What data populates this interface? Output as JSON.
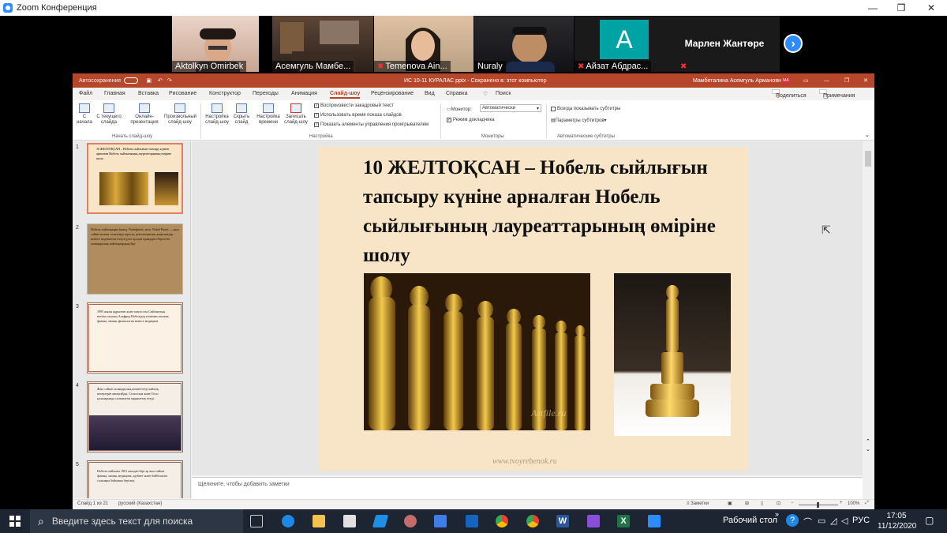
{
  "window": {
    "title": "Zoom Конференция",
    "min": "—",
    "max": "❐",
    "close": "✕"
  },
  "gallery": {
    "participants": [
      {
        "name": "Aktolkyn Omirbek",
        "muted": false
      },
      {
        "name": "Асемгуль Мамбе...",
        "muted": false
      },
      {
        "name": "Temenova Ain...",
        "muted": true
      },
      {
        "name": "Nuraly",
        "muted": false
      },
      {
        "name": "Айзат Абдрас...",
        "muted": true,
        "initial": "A"
      },
      {
        "name": "Марлен Жантөре",
        "muted": true
      }
    ],
    "next_page_icon": "chevron-right-icon"
  },
  "ppt": {
    "autosave_label": "Автосохранение",
    "file_title": "ИС 10-11 КУРАЛАС pptx - Сохранено в: этот компьютер",
    "user": "Мамбеталина Асемгуль Армановна",
    "user_initials": "МА",
    "tabs": [
      "Файл",
      "Главная",
      "Вставка",
      "Рисование",
      "Конструктор",
      "Переходы",
      "Анимация",
      "Слайд-шоу",
      "Рецензирование",
      "Вид",
      "Справка"
    ],
    "active_tab": "Слайд-шоу",
    "search_label": "Поиск",
    "share_label": "Поделиться",
    "comments_label": "Примечания",
    "ribbon": {
      "from_start": "С начала",
      "from_current": "С текущего слайда",
      "online": "Онлайн-презентация",
      "custom": "Произвольный слайд-шоу",
      "group_start": "Начать слайд-шоу",
      "setup": "Настройка слайд-шоу",
      "hide": "Скрыть слайд",
      "timing": "Настройка времени",
      "record": "Записать слайд-шоу",
      "chk_narration": "Воспроизвести закадровый текст",
      "chk_timings": "Использовать время показа слайдов",
      "chk_controls": "Показать элементы управления проигрывателем",
      "group_setup": "Настройка",
      "monitor_label": "Монитор:",
      "monitor_value": "Автоматически",
      "presenter_view": "Режим докладчика",
      "group_monitors": "Мониторы",
      "subtitles_always": "Всегда показывать субтитры",
      "subtitle_settings": "Параметры субтитров",
      "group_subtitles": "Автоматические субтитры"
    },
    "thumbnails": [
      {
        "num": "1",
        "text": "10 ЖЕЛТОҚСАН – Нобель сыйлығын тапсыру күніне арналған Нобель сыйлығының лауреаттарының өміріне шолу"
      },
      {
        "num": "2",
        "text": "Нобель сыйлықтары (швед. Nobelpriset, англ. Nobel Prize) — жыл сайын ғылым саласында зерттеу, революциялық жаңалықтар немесе мәдениетке елеулі үлес қосқан адамдарға берілетін халықаралық сыйлықтардың бірі"
      },
      {
        "num": "3",
        "text": "1895 жылы құрылған және атауы осы Сыйлықтың негізін салушы Альфред Нобельдің есімімен аталған: физика, химия, физиология немесе медицина"
      },
      {
        "num": "4",
        "text": "Жыл сайын халықаралық комитеттер сыйлық иегерлерін анықтайды. Стокгольм және Осло қалаларында салтанатты марапаттау өтеді."
      },
      {
        "num": "5",
        "text": "Нобель сыйлығы 1901 жылдан бері әр жыл сайын физика, химия, медицина, әдебиет және бейбітшілік салалары бойынша беріледі"
      }
    ],
    "slide": {
      "title": "10 ЖЕЛТОҚСАН – Нобель сыйлығын тапсыру күніне арналған Нобель сыйлығының лауреаттарының өміріне шолу",
      "image1_watermark": "Artfile.ru",
      "footer_watermark": "www.tvoyrebenok.ru"
    },
    "notes_placeholder": "Щелкните, чтобы добавить заметки",
    "status": {
      "slide_counter": "Слайд 1 из 21",
      "language": "русский (Казахстан)",
      "notes_btn": "Заметки",
      "zoom": "100%"
    }
  },
  "taskbar": {
    "search_placeholder": "Введите здесь текст для поиска",
    "desktop_label": "Рабочий стол",
    "lang": "РУС",
    "time": "17:05",
    "date": "11/12/2020"
  },
  "colors": {
    "ppt_accent": "#b7472a",
    "zoom_blue": "#2d8cff",
    "slide_bg": "#f8e5c8",
    "taskbar": "#1d2533"
  }
}
